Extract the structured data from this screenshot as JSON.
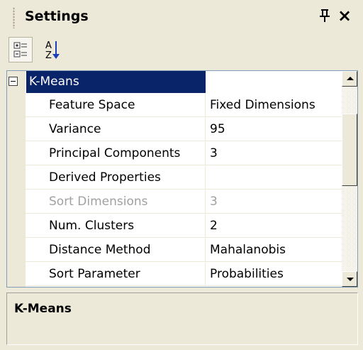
{
  "panel": {
    "title": "Settings",
    "pin_icon": "pin-icon",
    "close_label": "×"
  },
  "toolbar": {
    "categorized_icon": "categorized-icon",
    "alphabetical_icon": "alphabetical-sort-icon",
    "az_top": "A",
    "az_bottom": "Z"
  },
  "grid": {
    "category": {
      "label": "K-Means",
      "expanded": true
    },
    "properties": [
      {
        "name": "Feature Space",
        "value": "Fixed Dimensions",
        "enabled": true
      },
      {
        "name": "Variance",
        "value": "95",
        "enabled": true
      },
      {
        "name": "Principal Components",
        "value": "3",
        "enabled": true
      },
      {
        "name": "Derived Properties",
        "value": "",
        "enabled": true
      },
      {
        "name": "Sort Dimensions",
        "value": "3",
        "enabled": false
      },
      {
        "name": "Num. Clusters",
        "value": "2",
        "enabled": true
      },
      {
        "name": "Distance Method",
        "value": "Mahalanobis",
        "enabled": true
      },
      {
        "name": "Sort Parameter",
        "value": "Probabilities",
        "enabled": true
      }
    ]
  },
  "description": {
    "title": "K-Means"
  },
  "colors": {
    "selection": "#0a246a",
    "background": "#ece9d8",
    "disabled_text": "#a0a0a0"
  }
}
